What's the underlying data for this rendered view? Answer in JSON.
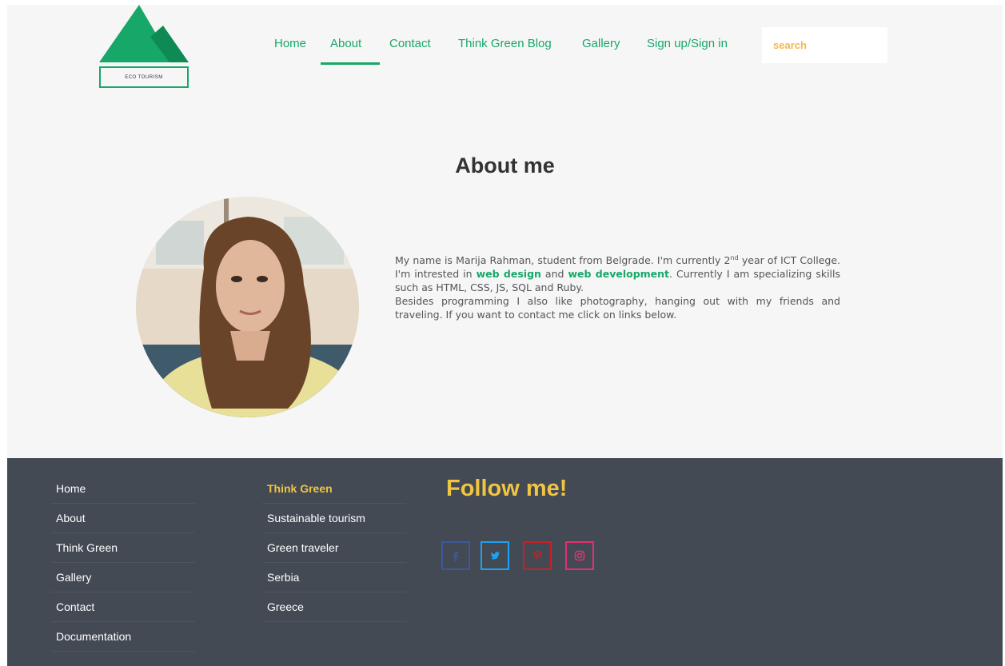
{
  "logo": {
    "text": "ECO TOURISM"
  },
  "nav": [
    {
      "label": "Home"
    },
    {
      "label": "About"
    },
    {
      "label": "Contact"
    },
    {
      "label": "Think Green Blog"
    },
    {
      "label": "Gallery"
    },
    {
      "label": "Sign up/Sign in"
    }
  ],
  "search": {
    "placeholder": "search"
  },
  "about": {
    "title": "About me",
    "bio": {
      "p1_a": "My name is Marija Rahman, student from Belgrade. I'm currently 2",
      "p1_sup": "nd",
      "p1_b": " year of ICT College. I'm intrested in ",
      "link1": "web design",
      "p1_c": " and ",
      "link2": "web development",
      "p1_d": ". Currently I am specializing skills such as HTML, CSS, JS, SQL and Ruby.",
      "p2": "Besides programming I also like photography, hanging out with my friends and traveling. If you want to contact me click on links below."
    }
  },
  "footer": {
    "col1": [
      "Home",
      "About",
      "Think Green",
      "Gallery",
      "Contact",
      "Documentation"
    ],
    "col2": [
      "Think Green",
      "Sustainable tourism",
      "Green traveler",
      "Serbia",
      "Greece"
    ],
    "follow_title": "Follow me!",
    "social": [
      {
        "icon": "facebook-icon",
        "color": "#3b5998"
      },
      {
        "icon": "twitter-icon",
        "color": "#1da1f2"
      },
      {
        "icon": "pinterest-icon",
        "color": "#cb2027"
      },
      {
        "icon": "instagram-icon",
        "color": "#e1306c"
      }
    ]
  },
  "colors": {
    "brand_green": "#17a769",
    "accent_yellow": "#f0c541",
    "footer_bg": "#434a54"
  }
}
